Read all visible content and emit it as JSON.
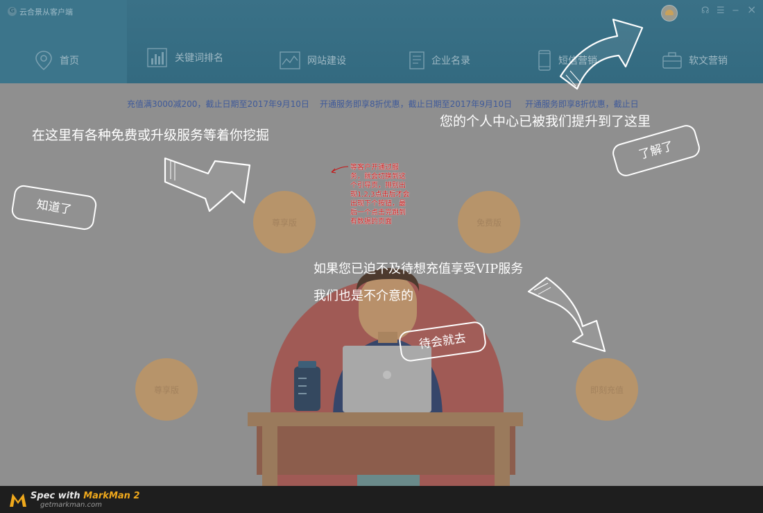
{
  "app": {
    "title": "云合景从客户端",
    "logo_letter": "G"
  },
  "nav": [
    {
      "label": "首页",
      "icon": "location-pin-icon"
    },
    {
      "label": "关键词排名",
      "icon": "bar-chart-icon"
    },
    {
      "label": "网站建设",
      "icon": "line-chart-icon"
    },
    {
      "label": "企业名录",
      "icon": "directory-icon"
    },
    {
      "label": "短信营销",
      "icon": "phone-icon"
    },
    {
      "label": "软文营销",
      "icon": "briefcase-icon"
    }
  ],
  "window_controls": {
    "headset": "☊",
    "menu": "☰",
    "minimize": "−",
    "close": "×"
  },
  "promos": [
    "充值满3000减200，截止日期至2017年9月10日",
    "开通服务即享8折优惠，截止日期至2017年9月10日",
    "开通服务即享8折优惠，截止日"
  ],
  "guide": {
    "text_free_services": "在这里有各种免费或升级服务等着你挖掘",
    "text_profile": "您的个人中心已被我们提升到了这里",
    "text_vip_line1": "如果您已迫不及待想充值享受VIP服务",
    "text_vip_line2": "我们也是不介意的",
    "btn_got_it": "知道了",
    "btn_understood": "了解了",
    "btn_later": "待会就去"
  },
  "circles": {
    "top_left": "尊享版",
    "top_right": "免费版",
    "bottom_left": "尊享版",
    "bottom_right": "即刻充值"
  },
  "annotation": "等客户开通过服务，就会切换到这个引导页，排别出现1,2,3点击后才会出现下个按钮，最后一个点击完跳到有数据的页面",
  "markman": {
    "line1_prefix": "Spec with ",
    "line1_brand": "MarkMan 2",
    "line2": "getmarkman.com"
  },
  "colors": {
    "topbar": "#336a80",
    "overlay": "#8f8f8f",
    "circle": "#b7946a",
    "annotation": "#c81010",
    "promo": "#3f5a9a"
  }
}
